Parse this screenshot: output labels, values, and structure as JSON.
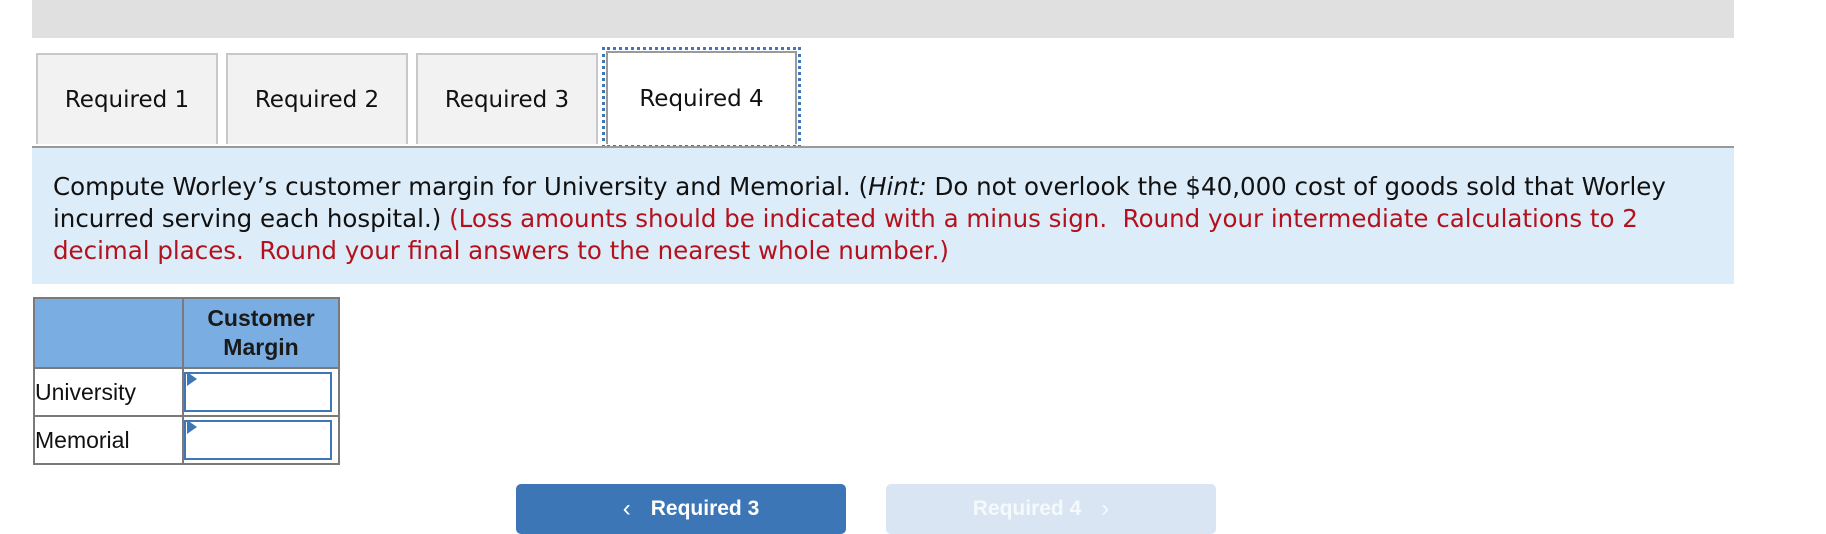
{
  "tabs": [
    {
      "label": "Required 1",
      "active": false
    },
    {
      "label": "Required 2",
      "active": false
    },
    {
      "label": "Required 3",
      "active": false
    },
    {
      "label": "Required 4",
      "active": true
    }
  ],
  "instructions": {
    "part1": "Compute Worley’s customer margin for University and Memorial. (",
    "hint_label": "Hint:",
    "part2": " Do not overlook the $40,000 cost of goods sold that Worley incurred serving each hospital.)",
    "warning": " (Loss amounts should be indicated with a minus sign.  Round your intermediate calculations to 2 decimal places.  Round your final answers to the nearest whole number.)"
  },
  "table": {
    "column_header_line1": "Customer",
    "column_header_line2": "Margin",
    "rows": [
      {
        "label": "University",
        "value": ""
      },
      {
        "label": "Memorial",
        "value": ""
      }
    ]
  },
  "nav": {
    "prev_label": "Required 3",
    "prev_icon": "chevron-left-icon",
    "prev_glyph": "‹",
    "next_label": "Required 4",
    "next_icon": "chevron-right-icon",
    "next_glyph": "›",
    "next_disabled": true
  },
  "colors": {
    "accent": "#3d76b6",
    "warning_text": "#b3121d",
    "instructions_bg": "#dcecf8",
    "table_header_bg": "#7aaee2"
  }
}
